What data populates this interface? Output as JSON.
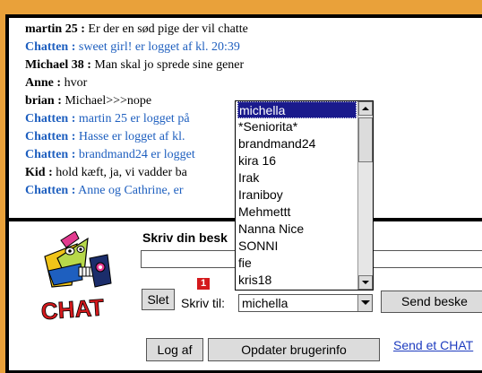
{
  "chat_log": [
    {
      "name": "martin 25",
      "text": " Er der en sød pige der vil chatte",
      "kind": "user"
    },
    {
      "name": "Chatten",
      "text": " sweet girl! er logget af kl. 20:39",
      "kind": "sys"
    },
    {
      "name": "Michael 38",
      "text": " Man skal jo sprede sine gener",
      "kind": "user"
    },
    {
      "name": "Anne",
      "text": " hvor",
      "kind": "user"
    },
    {
      "name": "brian",
      "text": " Michael>>>nope",
      "kind": "user"
    },
    {
      "name": "Chatten",
      "text": " martin 25 er logget på",
      "kind": "sys"
    },
    {
      "name": "Chatten",
      "text": " Hasse er logget af kl.",
      "kind": "sys"
    },
    {
      "name": "Chatten",
      "text": " brandmand24 er logget",
      "kind": "sys"
    },
    {
      "name": "Kid",
      "text": " hold kæft, ja, vi vadder ba",
      "kind": "user"
    },
    {
      "name": "Chatten",
      "text": " Anne og Cathrine, er",
      "kind": "sys"
    }
  ],
  "separator": " :",
  "compose": {
    "label": "Skriv din besk",
    "message_value": "",
    "badge": "1",
    "delete_label": "Slet",
    "write_to_label": "Skriv til:",
    "recipient_selected": "michella",
    "send_label": "Send beske"
  },
  "recipients": [
    "michella",
    "*Seniorita*",
    "brandmand24",
    "kira 16",
    "Irak",
    "Iraniboy",
    "Mehmettt",
    "Nanna Nice",
    "SONNI",
    "fie",
    "kris18"
  ],
  "footer": {
    "logout_label": "Log af",
    "refresh_label": "Opdater brugerinfo",
    "link_label": "Send et CHAT"
  },
  "logo": {
    "text": "CHAT"
  },
  "colors": {
    "background": "#e9a13a",
    "system": "#1e5fbf",
    "selection": "#1a1a8c",
    "badge": "#d4191c"
  }
}
